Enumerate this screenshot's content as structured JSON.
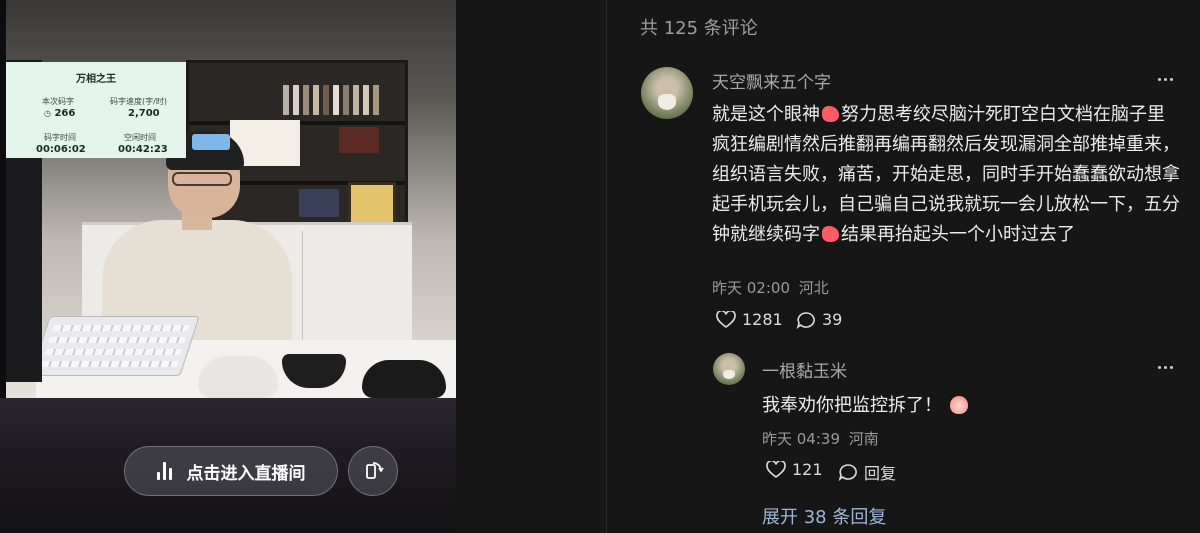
{
  "video": {
    "stats": {
      "title": "万相之王",
      "session_words_label": "本次码字",
      "session_words_value": "266",
      "speed_label": "码字速度(字/时)",
      "speed_value": "2,700",
      "typing_time_label": "码字时间",
      "typing_time_value": "00:06:02",
      "idle_time_label": "空闲时间",
      "idle_time_value": "00:42:23"
    },
    "live_button_label": "点击进入直播间",
    "rotate_icon": "rotate-screen-icon"
  },
  "comments": {
    "header": "共 125 条评论",
    "items": [
      {
        "username": "天空飘来五个字",
        "text_part1": "就是这个眼神",
        "text_part2": "努力思考绞尽脑汁死盯空白文档在脑子里疯狂编剧情然后推翻再编再翻然后发现漏洞全部推掉重来，组织语言失败，痛苦，开始走思，同时手开始蠢蠢欲动想拿起手机玩会儿，自己骗自己说我就玩一会儿放松一下，五分钟就继续码字",
        "text_part3": "结果再抬起头一个小时过去了",
        "time": "昨天 02:00",
        "location": "河北",
        "likes": "1281",
        "replies": "39",
        "reply": {
          "username": "一根黏玉米",
          "text": "我奉劝你把监控拆了！",
          "time": "昨天 04:39",
          "location": "河南",
          "likes": "121",
          "reply_label": "回复"
        },
        "expand_label": "展开 38 条回复"
      }
    ]
  },
  "colors": {
    "background": "#161616",
    "text_primary": "#ececec",
    "text_secondary": "#9a9a9a",
    "expand_link": "#9fb7d8",
    "stats_bg": "#e3f5ea"
  }
}
